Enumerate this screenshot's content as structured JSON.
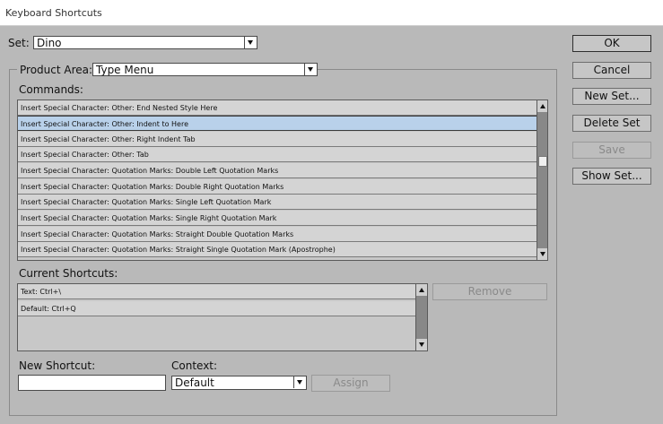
{
  "window": {
    "title": "Keyboard Shortcuts"
  },
  "set": {
    "label": "Set:",
    "value": "Dino"
  },
  "product_area": {
    "label": "Product Area:",
    "value": "Type Menu"
  },
  "commands": {
    "label": "Commands:",
    "items": [
      "Insert Special Character: Other: End Nested Style Here",
      "Insert Special Character: Other: Indent to Here",
      "Insert Special Character: Other: Right Indent Tab",
      "Insert Special Character: Other: Tab",
      "Insert Special Character: Quotation Marks: Double Left Quotation Marks",
      "Insert Special Character: Quotation Marks: Double Right Quotation Marks",
      "Insert Special Character: Quotation Marks: Single Left Quotation Mark",
      "Insert Special Character: Quotation Marks: Single Right Quotation Mark",
      "Insert Special Character: Quotation Marks: Straight Double Quotation Marks",
      "Insert Special Character: Quotation Marks: Straight Single Quotation Mark (Apostrophe)"
    ],
    "selected_index": 1
  },
  "current_shortcuts": {
    "label": "Current Shortcuts:",
    "items": [
      "Text: Ctrl+\\",
      "Default: Ctrl+Q"
    ],
    "remove_label": "Remove"
  },
  "new_shortcut": {
    "label": "New Shortcut:",
    "value": ""
  },
  "context": {
    "label": "Context:",
    "value": "Default",
    "assign_label": "Assign"
  },
  "buttons": {
    "ok": "OK",
    "cancel": "Cancel",
    "new_set": "New Set...",
    "delete_set": "Delete Set",
    "save": "Save",
    "show_set": "Show Set..."
  },
  "colors": {
    "selection": "#b9d1ea",
    "background": "#b9b9b9"
  }
}
